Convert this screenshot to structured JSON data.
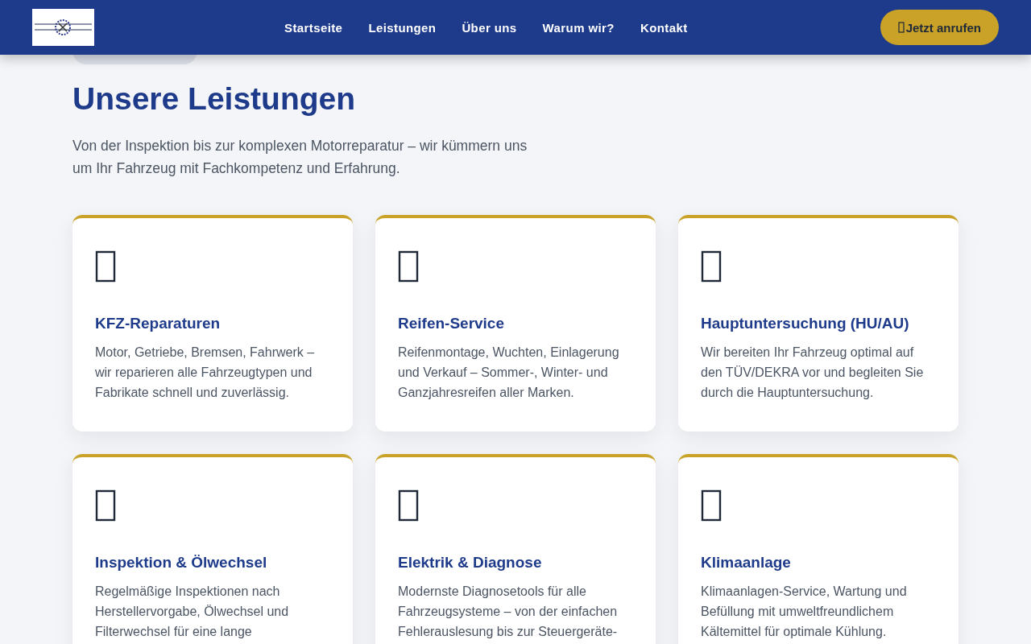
{
  "header": {
    "nav": [
      {
        "label": "Startseite"
      },
      {
        "label": "Leistungen"
      },
      {
        "label": "Über uns"
      },
      {
        "label": "Warum wir?"
      },
      {
        "label": "Kontakt"
      }
    ],
    "call_button": "Jetzt anrufen"
  },
  "section": {
    "title": "Unsere Leistungen",
    "intro": "Von der Inspektion bis zur komplexen Motorreparatur – wir kümmern uns um Ihr Fahrzeug mit Fachkompetenz und Erfahrung.",
    "cards": [
      {
        "title": "KFZ-Reparaturen",
        "text": "Motor, Getriebe, Bremsen, Fahrwerk – wir reparieren alle Fahrzeugtypen und Fabrikate schnell und zuverlässig."
      },
      {
        "title": "Reifen-Service",
        "text": "Reifenmontage, Wuchten, Einlagerung und Verkauf – Sommer-, Winter- und Ganzjahresreifen aller Marken."
      },
      {
        "title": "Hauptuntersuchung (HU/AU)",
        "text": "Wir bereiten Ihr Fahrzeug optimal auf den TÜV/DEKRA vor und begleiten Sie durch die Hauptuntersuchung."
      },
      {
        "title": "Inspektion & Ölwechsel",
        "text": "Regelmäßige Inspektionen nach Herstellervorgabe, Ölwechsel und Filterwechsel für eine lange"
      },
      {
        "title": "Elektrik & Diagnose",
        "text": "Modernste Diagnosetools für alle Fahrzeugsysteme – von der einfachen Fehlerauslesung bis zur Steuergeräte-"
      },
      {
        "title": "Klimaanlage",
        "text": "Klimaanlagen-Service, Wartung und Befüllung mit umweltfreundlichem Kältemittel für optimale Kühlung."
      }
    ]
  }
}
